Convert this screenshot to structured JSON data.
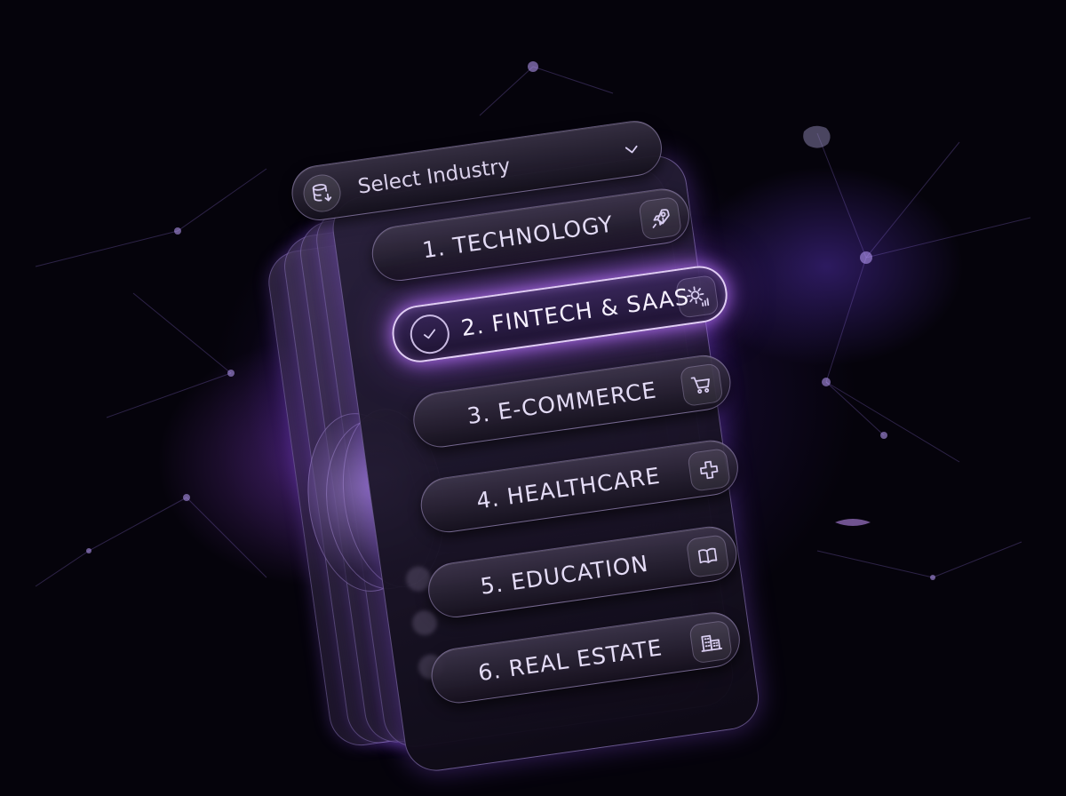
{
  "dropdown": {
    "header": {
      "label": "Select Industry",
      "leading_icon": "database-download-icon",
      "trailing_icon": "chevron-down-icon"
    },
    "selected_index": 1,
    "options": [
      {
        "label": "1. TECHNOLOGY",
        "icon": "rocket-icon",
        "selected": false
      },
      {
        "label": "2. FINTECH & SAAS",
        "icon": "gear-chart-icon",
        "selected": true
      },
      {
        "label": "3. E-COMMERCE",
        "icon": "shopping-cart-icon",
        "selected": false
      },
      {
        "label": "4. HEALTHCARE",
        "icon": "medical-cross-icon",
        "selected": false
      },
      {
        "label": "5. EDUCATION",
        "icon": "open-book-icon",
        "selected": false
      },
      {
        "label": "6. REAL ESTATE",
        "icon": "buildings-icon",
        "selected": false
      }
    ]
  },
  "colors": {
    "accent": "#a86bff",
    "glow": "#9b4dff",
    "background": "#05030b",
    "text": "#e4dcf6"
  }
}
